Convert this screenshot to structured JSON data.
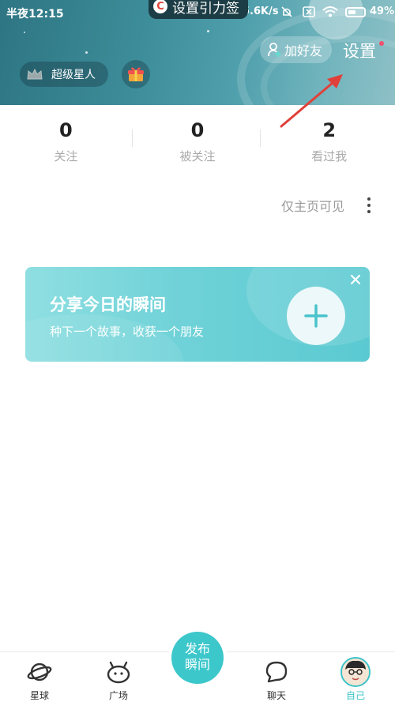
{
  "status_bar": {
    "time": "半夜12:15",
    "speed": "5.6K/s",
    "battery": "49%",
    "battery_level": 0.49
  },
  "overlay": {
    "badge": "C",
    "label": "设置引力签"
  },
  "header": {
    "add_friend_label": "加好友",
    "settings_label": "设置",
    "superstar_label": "超级星人"
  },
  "stats": [
    {
      "value": "0",
      "label": "关注"
    },
    {
      "value": "0",
      "label": "被关注"
    },
    {
      "value": "2",
      "label": "看过我"
    }
  ],
  "visibility_label": "仅主页可见",
  "share_card": {
    "title": "分享今日的瞬间",
    "subtitle": "种下一个故事，收获一个朋友"
  },
  "tabbar": {
    "items": [
      {
        "label": "星球",
        "icon": "planet-icon"
      },
      {
        "label": "广场",
        "icon": "square-icon"
      },
      {
        "label": "聊天",
        "icon": "chat-bubble-icon"
      },
      {
        "label": "自己",
        "icon": "avatar"
      }
    ],
    "publish_line1": "发布",
    "publish_line2": "瞬间"
  },
  "colors": {
    "accent": "#3cc7cb",
    "header": "#3d8c99",
    "annotation_arrow": "#e0403a",
    "notification_dot": "#f0506e"
  }
}
